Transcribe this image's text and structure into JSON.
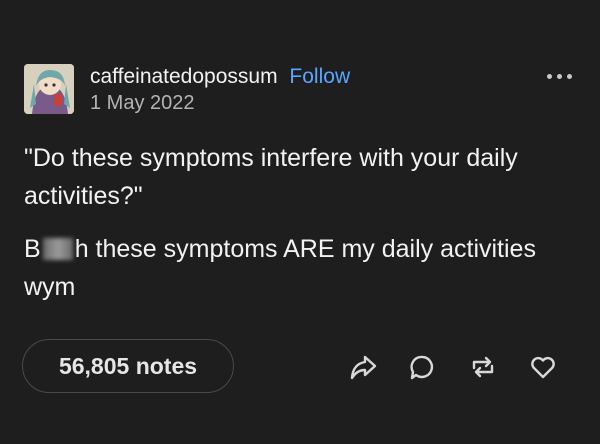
{
  "post": {
    "username": "caffeinatedopossum",
    "follow_label": "Follow",
    "date": "1 May 2022",
    "quote_text": "\"Do these symptoms interfere with your daily activities?\"",
    "reply_start": "B",
    "reply_rest": "h these symptoms ARE my daily activities wym",
    "notes_label": "56,805 notes"
  },
  "icons": {
    "avatar": "anime-character-avatar",
    "more": "more-options-icon",
    "share": "share-icon",
    "reply": "reply-icon",
    "reblog": "reblog-icon",
    "like": "heart-icon"
  },
  "colors": {
    "background": "#1e1e1e",
    "text": "#f2f2f2",
    "follow": "#58a6ff",
    "muted": "#b4b4b4"
  }
}
